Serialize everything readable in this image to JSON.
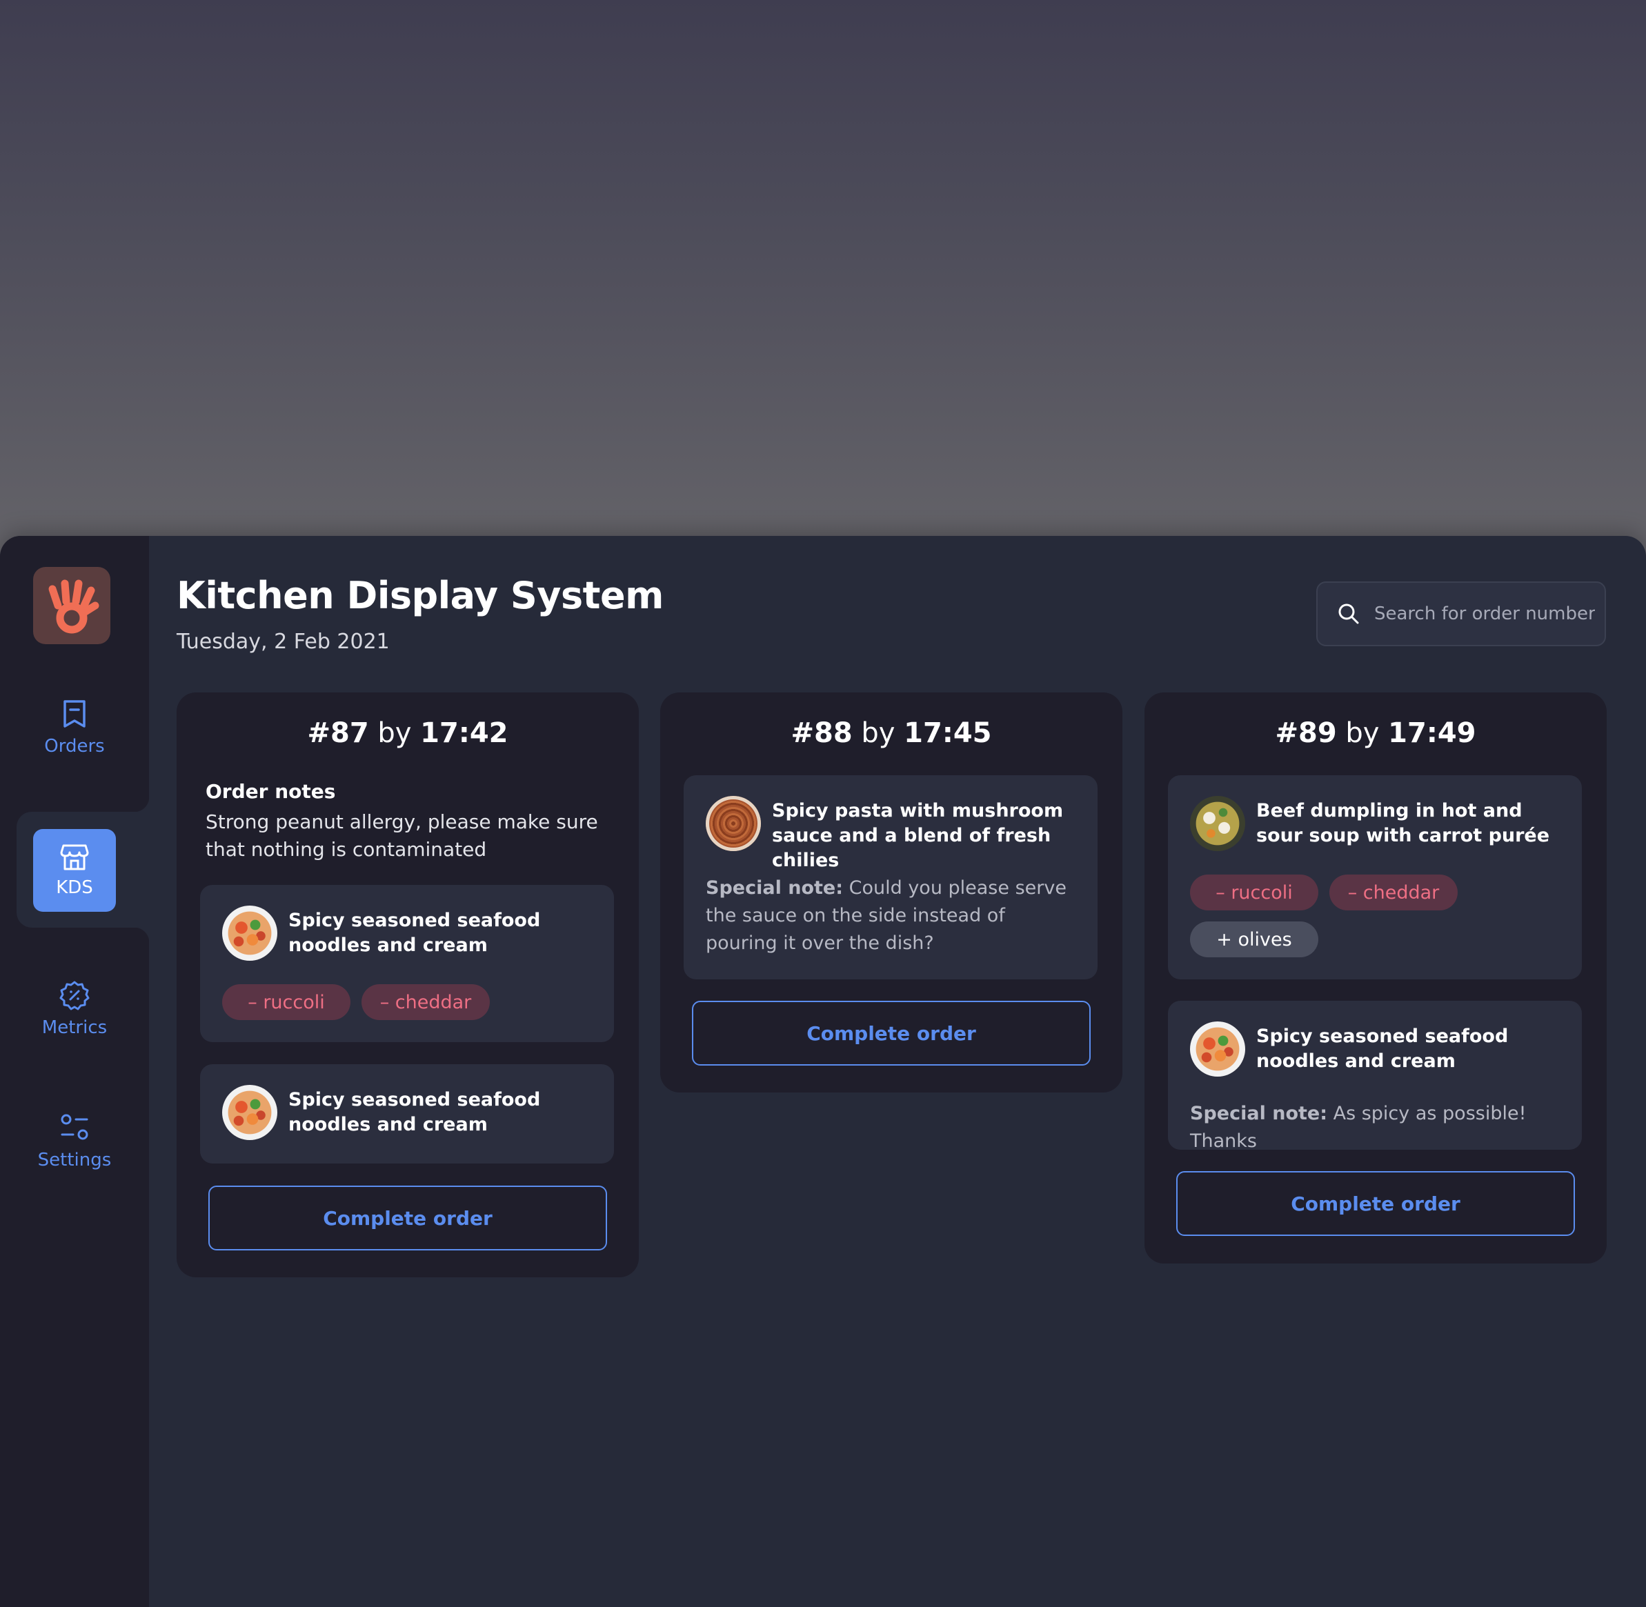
{
  "app": {
    "title": "Kitchen Display System",
    "date": "Tuesday, 2 Feb 2021"
  },
  "colors": {
    "accent": "#5b8def",
    "sidebar_bg": "#1f1e2b",
    "main_bg": "#262a39",
    "card_bg": "#1f1e2b",
    "item_bg": "#2b2e3e",
    "remove_chip_bg": "#5a3445",
    "remove_chip_text": "#ee6f84",
    "add_chip_bg": "#4a4e5e",
    "logo_bg": "#5a3d3e",
    "logo_color": "#f06e55"
  },
  "sidebar": {
    "logo_icon": "hand-logo-icon",
    "items": [
      {
        "label": "Orders",
        "icon": "receipt-icon",
        "active": false
      },
      {
        "label": "KDS",
        "icon": "store-icon",
        "active": true
      },
      {
        "label": "Metrics",
        "icon": "badge-percent-icon",
        "active": false
      },
      {
        "label": "Settings",
        "icon": "sliders-icon",
        "active": false
      }
    ]
  },
  "search": {
    "placeholder": "Search for order number",
    "value": "",
    "icon": "search-icon"
  },
  "orders": [
    {
      "number": "#87",
      "by": "by",
      "time": "17:42",
      "notes_label": "Order notes",
      "notes": "Strong peanut allergy, please make sure that nothing is contaminated",
      "items": [
        {
          "name": "Spicy seasoned seafood noodles and cream",
          "modifiers": [
            "– ruccoli",
            "– cheddar"
          ]
        },
        {
          "name": "Spicy seasoned seafood noodles and cream",
          "modifiers": []
        }
      ],
      "action": "Complete order"
    },
    {
      "number": "#88",
      "by": "by",
      "time": "17:45",
      "items": [
        {
          "name": "Spicy pasta with mushroom sauce and a blend of fresh chilies",
          "special_note_label": "Special note:",
          "special_note": "Could you please serve the sauce on the side instead of pouring it over the dish?"
        }
      ],
      "action": "Complete order"
    },
    {
      "number": "#89",
      "by": "by",
      "time": "17:49",
      "items": [
        {
          "name": "Beef dumpling in hot and sour soup with carrot purée",
          "modifiers": [
            "– ruccoli",
            "– cheddar"
          ],
          "additions": [
            "+ olives"
          ]
        },
        {
          "name": "Spicy seasoned seafood noodles and cream",
          "special_note_label": "Special note:",
          "special_note": "As spicy as possible! Thanks"
        }
      ],
      "action": "Complete order"
    }
  ]
}
